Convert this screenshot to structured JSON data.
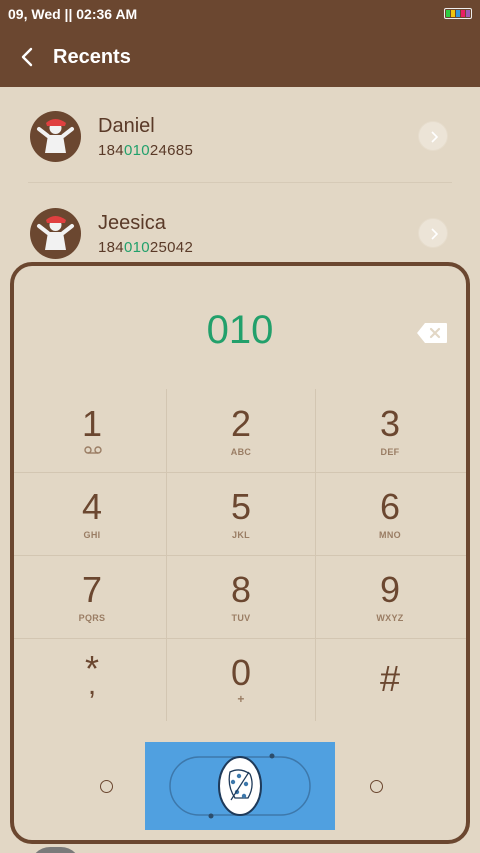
{
  "status_bar": {
    "time": "09, Wed || 02:36 AM",
    "battery_colors": [
      "#2ecc40",
      "#f1c40f",
      "#3498db",
      "#e91e63",
      "#9b59b6"
    ]
  },
  "header": {
    "title": "Recents",
    "back_icon": "chevron-left-icon"
  },
  "recents": [
    {
      "name": "Daniel",
      "number_prefix": "184",
      "number_match": "010",
      "number_suffix": "24685"
    },
    {
      "name": "Jeesica",
      "number_prefix": "184",
      "number_match": "010",
      "number_suffix": "25042"
    }
  ],
  "dialer": {
    "number": "010",
    "keys": [
      {
        "digit": "1",
        "letters": "",
        "sub_icon": "voicemail-icon"
      },
      {
        "digit": "2",
        "letters": "ABC"
      },
      {
        "digit": "3",
        "letters": "DEF"
      },
      {
        "digit": "4",
        "letters": "GHI"
      },
      {
        "digit": "5",
        "letters": "JKL"
      },
      {
        "digit": "6",
        "letters": "MNO"
      },
      {
        "digit": "7",
        "letters": "PQRS"
      },
      {
        "digit": "8",
        "letters": "TUV"
      },
      {
        "digit": "9",
        "letters": "WXYZ"
      },
      {
        "digit": "*",
        "letters": ""
      },
      {
        "digit": "0",
        "letters": "+"
      },
      {
        "digit": "#",
        "letters": ""
      }
    ],
    "key_star_sub": ",",
    "accent_color": "#22a06b",
    "call_button_color": "#50a0e0"
  }
}
